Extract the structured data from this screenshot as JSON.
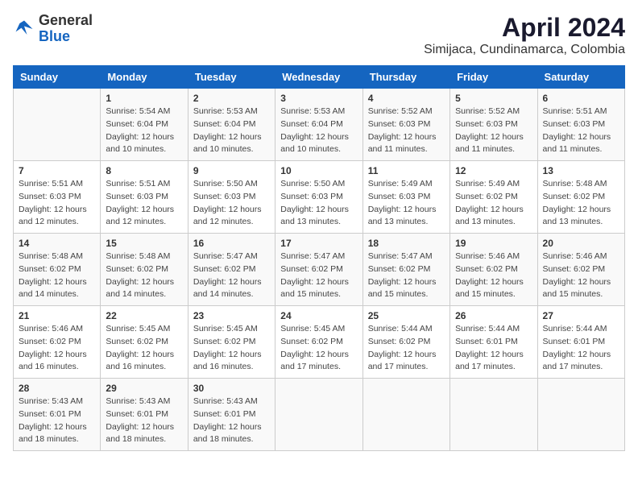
{
  "logo": {
    "line1": "General",
    "line2": "Blue"
  },
  "title": "April 2024",
  "subtitle": "Simijaca, Cundinamarca, Colombia",
  "headers": [
    "Sunday",
    "Monday",
    "Tuesday",
    "Wednesday",
    "Thursday",
    "Friday",
    "Saturday"
  ],
  "weeks": [
    [
      {
        "day": "",
        "info": ""
      },
      {
        "day": "1",
        "info": "Sunrise: 5:54 AM\nSunset: 6:04 PM\nDaylight: 12 hours\nand 10 minutes."
      },
      {
        "day": "2",
        "info": "Sunrise: 5:53 AM\nSunset: 6:04 PM\nDaylight: 12 hours\nand 10 minutes."
      },
      {
        "day": "3",
        "info": "Sunrise: 5:53 AM\nSunset: 6:04 PM\nDaylight: 12 hours\nand 10 minutes."
      },
      {
        "day": "4",
        "info": "Sunrise: 5:52 AM\nSunset: 6:03 PM\nDaylight: 12 hours\nand 11 minutes."
      },
      {
        "day": "5",
        "info": "Sunrise: 5:52 AM\nSunset: 6:03 PM\nDaylight: 12 hours\nand 11 minutes."
      },
      {
        "day": "6",
        "info": "Sunrise: 5:51 AM\nSunset: 6:03 PM\nDaylight: 12 hours\nand 11 minutes."
      }
    ],
    [
      {
        "day": "7",
        "info": "Sunrise: 5:51 AM\nSunset: 6:03 PM\nDaylight: 12 hours\nand 12 minutes."
      },
      {
        "day": "8",
        "info": "Sunrise: 5:51 AM\nSunset: 6:03 PM\nDaylight: 12 hours\nand 12 minutes."
      },
      {
        "day": "9",
        "info": "Sunrise: 5:50 AM\nSunset: 6:03 PM\nDaylight: 12 hours\nand 12 minutes."
      },
      {
        "day": "10",
        "info": "Sunrise: 5:50 AM\nSunset: 6:03 PM\nDaylight: 12 hours\nand 13 minutes."
      },
      {
        "day": "11",
        "info": "Sunrise: 5:49 AM\nSunset: 6:03 PM\nDaylight: 12 hours\nand 13 minutes."
      },
      {
        "day": "12",
        "info": "Sunrise: 5:49 AM\nSunset: 6:02 PM\nDaylight: 12 hours\nand 13 minutes."
      },
      {
        "day": "13",
        "info": "Sunrise: 5:48 AM\nSunset: 6:02 PM\nDaylight: 12 hours\nand 13 minutes."
      }
    ],
    [
      {
        "day": "14",
        "info": "Sunrise: 5:48 AM\nSunset: 6:02 PM\nDaylight: 12 hours\nand 14 minutes."
      },
      {
        "day": "15",
        "info": "Sunrise: 5:48 AM\nSunset: 6:02 PM\nDaylight: 12 hours\nand 14 minutes."
      },
      {
        "day": "16",
        "info": "Sunrise: 5:47 AM\nSunset: 6:02 PM\nDaylight: 12 hours\nand 14 minutes."
      },
      {
        "day": "17",
        "info": "Sunrise: 5:47 AM\nSunset: 6:02 PM\nDaylight: 12 hours\nand 15 minutes."
      },
      {
        "day": "18",
        "info": "Sunrise: 5:47 AM\nSunset: 6:02 PM\nDaylight: 12 hours\nand 15 minutes."
      },
      {
        "day": "19",
        "info": "Sunrise: 5:46 AM\nSunset: 6:02 PM\nDaylight: 12 hours\nand 15 minutes."
      },
      {
        "day": "20",
        "info": "Sunrise: 5:46 AM\nSunset: 6:02 PM\nDaylight: 12 hours\nand 15 minutes."
      }
    ],
    [
      {
        "day": "21",
        "info": "Sunrise: 5:46 AM\nSunset: 6:02 PM\nDaylight: 12 hours\nand 16 minutes."
      },
      {
        "day": "22",
        "info": "Sunrise: 5:45 AM\nSunset: 6:02 PM\nDaylight: 12 hours\nand 16 minutes."
      },
      {
        "day": "23",
        "info": "Sunrise: 5:45 AM\nSunset: 6:02 PM\nDaylight: 12 hours\nand 16 minutes."
      },
      {
        "day": "24",
        "info": "Sunrise: 5:45 AM\nSunset: 6:02 PM\nDaylight: 12 hours\nand 17 minutes."
      },
      {
        "day": "25",
        "info": "Sunrise: 5:44 AM\nSunset: 6:02 PM\nDaylight: 12 hours\nand 17 minutes."
      },
      {
        "day": "26",
        "info": "Sunrise: 5:44 AM\nSunset: 6:01 PM\nDaylight: 12 hours\nand 17 minutes."
      },
      {
        "day": "27",
        "info": "Sunrise: 5:44 AM\nSunset: 6:01 PM\nDaylight: 12 hours\nand 17 minutes."
      }
    ],
    [
      {
        "day": "28",
        "info": "Sunrise: 5:43 AM\nSunset: 6:01 PM\nDaylight: 12 hours\nand 18 minutes."
      },
      {
        "day": "29",
        "info": "Sunrise: 5:43 AM\nSunset: 6:01 PM\nDaylight: 12 hours\nand 18 minutes."
      },
      {
        "day": "30",
        "info": "Sunrise: 5:43 AM\nSunset: 6:01 PM\nDaylight: 12 hours\nand 18 minutes."
      },
      {
        "day": "",
        "info": ""
      },
      {
        "day": "",
        "info": ""
      },
      {
        "day": "",
        "info": ""
      },
      {
        "day": "",
        "info": ""
      }
    ]
  ]
}
